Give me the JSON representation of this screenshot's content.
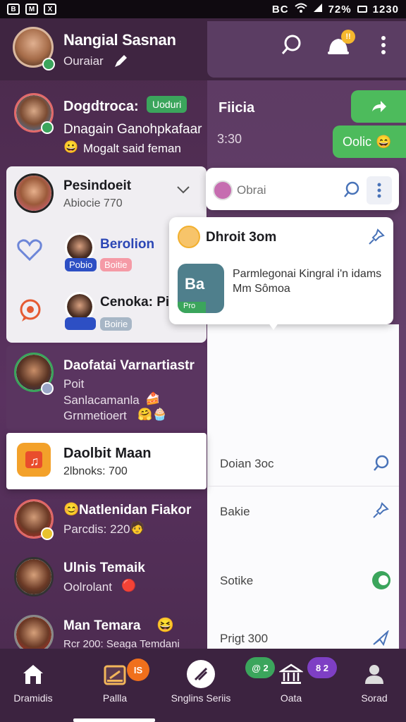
{
  "status_bar": {
    "left_icons": [
      "B",
      "M",
      "X"
    ],
    "right_text": "BC",
    "battery": "72%",
    "time": "1230"
  },
  "header": {
    "name": "Nangial Sasnan",
    "status": "Ouraiar",
    "badge_count": "!!"
  },
  "chats": [
    {
      "name": "Dogdtroca:",
      "tag": "Uoduri",
      "preview": "Dnagain Ganohpkafaar",
      "preview2": "Mogalt said feman"
    },
    {
      "name": "Pesindoeit",
      "time": "Abiocie 770"
    },
    {
      "name": "Berolion",
      "tag1": "Pobio",
      "tag2": "Boitie"
    },
    {
      "name": "Cenoka: Pir",
      "tag2": "Boirie"
    },
    {
      "name": "Daofatai Varnartiastr",
      "line2": "Poit",
      "line3": "Sanlacamanla",
      "line4": "Grnmetioert"
    },
    {
      "name": "Daolbit Maan",
      "time": "2lbnoks: 700"
    },
    {
      "name": "Natlenidan Fiakor",
      "time": "Parcdis: 220"
    },
    {
      "name": "Ulnis Temaik",
      "line2": "Oolrolant"
    },
    {
      "name": "Man Temara",
      "time": "Rcr 200: Seaga Temdani"
    }
  ],
  "right_panel": {
    "title": "Fiicia",
    "count": "3:30",
    "green_btn_label": "Oolic",
    "search_placeholder": "Obrai",
    "popup_title": "Dhroit 3om",
    "popup_text": "Parmlegonai Kingral i'n idams",
    "popup_text2": "Mm Sômoa",
    "popup_thumb": "Ba",
    "popup_thumb_tag": "Pro",
    "rows": [
      "Doian 3oc",
      "Bakie",
      "Sotike",
      "Prigt 300"
    ]
  },
  "bottom_nav": [
    {
      "label": "Dramidis",
      "icon": "home-icon"
    },
    {
      "label": "Pallla",
      "icon": "calendar-icon",
      "badge": "IS"
    },
    {
      "label": "Snglins Seriis",
      "icon": "compose-icon"
    },
    {
      "label": "Oata",
      "icon": "bank-icon",
      "badge": "@ 2"
    },
    {
      "label": "Sorad",
      "icon": "person-icon"
    }
  ],
  "nav_badges": {
    "n1": "IS",
    "n3a": "@ 2",
    "n3b": "8 2"
  },
  "colors": {
    "accent_green": "#4dbb5c",
    "badge_orange": "#f0701c",
    "purple": "#4a2b4d"
  }
}
